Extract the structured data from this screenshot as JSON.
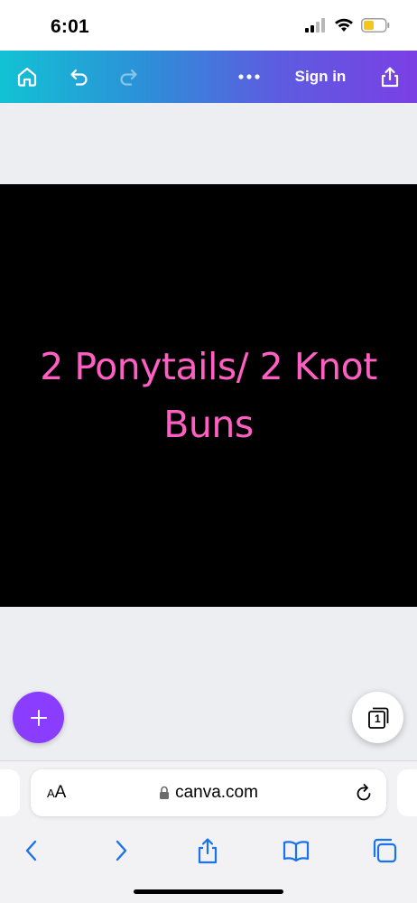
{
  "status_bar": {
    "time": "6:01"
  },
  "toolbar": {
    "home_icon": "home-icon",
    "undo_icon": "undo-icon",
    "redo_icon": "redo-icon",
    "more_icon": "more-icon",
    "sign_in_label": "Sign in",
    "share_icon": "share-icon",
    "gradient": [
      "#12c2d4",
      "#7b3fe4"
    ]
  },
  "design": {
    "text_line_1": "2 Ponytails/ 2 Knot",
    "text_line_2": "Buns",
    "text_color": "#ff5fc3",
    "background_color": "#000000"
  },
  "editor": {
    "add_button_icon": "plus-icon",
    "add_button_color": "#8b3dff",
    "page_count": "1"
  },
  "browser": {
    "text_size_label_small": "A",
    "text_size_label_large": "A",
    "url": "canva.com",
    "lock_icon": "lock-icon",
    "reload_icon": "reload-icon",
    "nav": [
      "back-icon",
      "forward-icon",
      "share-icon",
      "bookmarks-icon",
      "tabs-icon"
    ]
  }
}
